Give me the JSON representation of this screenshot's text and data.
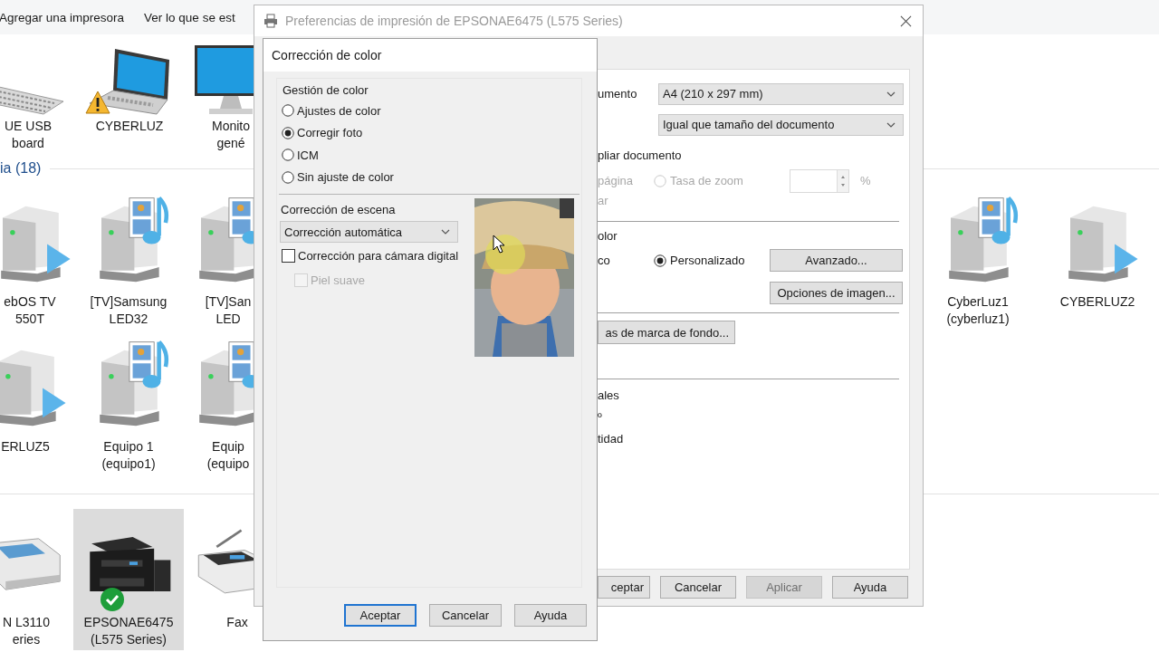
{
  "explorer": {
    "toolbar": [
      "Agregar una impresora",
      "Ver lo que se est"
    ],
    "group_heading": "ia (18)",
    "devices": [
      {
        "kind": "keyboard",
        "lines": [
          "UE USB",
          "board"
        ],
        "warning": false,
        "ok": false,
        "selected": false
      },
      {
        "kind": "laptop",
        "lines": [
          "CYBERLUZ"
        ],
        "warning": true,
        "ok": false,
        "selected": false
      },
      {
        "kind": "monitor",
        "lines": [
          "Monito",
          "gené"
        ],
        "warning": false,
        "ok": false,
        "selected": false
      },
      {
        "kind": "play-server",
        "lines": [
          "ebOS TV",
          "550T"
        ],
        "warning": false,
        "ok": false,
        "selected": false
      },
      {
        "kind": "media-server",
        "lines": [
          "[TV]Samsung",
          "LED32"
        ],
        "warning": false,
        "ok": false,
        "selected": false
      },
      {
        "kind": "media-server",
        "lines": [
          "[TV]San",
          "LED"
        ],
        "warning": false,
        "ok": false,
        "selected": false
      },
      {
        "kind": "media-server",
        "lines": [
          "CyberLuz1",
          "(cyberluz1)"
        ],
        "warning": false,
        "ok": false,
        "selected": false
      },
      {
        "kind": "play-server",
        "lines": [
          "CYBERLUZ2"
        ],
        "warning": false,
        "ok": false,
        "selected": false
      },
      {
        "kind": "play-server",
        "lines": [
          "ERLUZ5"
        ],
        "warning": false,
        "ok": false,
        "selected": false
      },
      {
        "kind": "media-server",
        "lines": [
          "Equipo 1",
          "(equipo1)"
        ],
        "warning": false,
        "ok": false,
        "selected": false
      },
      {
        "kind": "media-server",
        "lines": [
          "Equip",
          "(equipo"
        ],
        "warning": false,
        "ok": false,
        "selected": false
      },
      {
        "kind": "printer",
        "lines": [
          "N L3110",
          "eries"
        ],
        "warning": false,
        "ok": false,
        "selected": false
      },
      {
        "kind": "ink-printer",
        "lines": [
          "EPSONAE6475",
          "(L575 Series)"
        ],
        "warning": false,
        "ok": true,
        "selected": true
      },
      {
        "kind": "fax",
        "lines": [
          "Fax"
        ],
        "warning": false,
        "ok": false,
        "selected": false
      }
    ]
  },
  "preferences_window": {
    "title": "Preferencias de impresión de EPSONAE6475 (L575 Series)",
    "paper_size": {
      "label": "umento",
      "value": "A4 (210 x 297 mm)"
    },
    "output_size": {
      "value": "Igual que tamaño del documento"
    },
    "scale": {
      "label": "pliar documento",
      "fit_page": {
        "label": "página",
        "disabled": true
      },
      "zoom": {
        "label": "Tasa de zoom",
        "selected": false,
        "disabled": true
      },
      "unit": "%",
      "note": "ar"
    },
    "color": {
      "label": "olor",
      "option": "co",
      "custom": {
        "label": "Personalizado",
        "selected": true
      },
      "buttons": [
        "Avanzado...",
        "Opciones de imagen..."
      ]
    },
    "watermark_button": "as de marca de fondo...",
    "extra_lines": [
      "ales",
      "º",
      "tidad"
    ],
    "footer_buttons": [
      {
        "label": "ceptar",
        "disabled": false
      },
      {
        "label": "Cancelar",
        "disabled": false
      },
      {
        "label": "Aplicar",
        "disabled": true
      },
      {
        "label": "Ayuda",
        "disabled": false
      }
    ]
  },
  "color_dialog": {
    "title": "Corrección de color",
    "group": "Gestión de color",
    "modes": [
      {
        "label": "Ajustes de color",
        "selected": false
      },
      {
        "label": "Corregir foto",
        "selected": true
      },
      {
        "label": "ICM",
        "selected": false
      },
      {
        "label": "Sin ajuste de color",
        "selected": false
      }
    ],
    "scene": {
      "label": "Corrección de escena",
      "value": "Corrección automática"
    },
    "options": [
      {
        "label": "Corrección para cámara digital",
        "checked": false,
        "disabled": false,
        "children": [
          {
            "label": "Piel suave",
            "checked": false,
            "disabled": true
          }
        ]
      }
    ],
    "buttons": [
      {
        "label": "Aceptar",
        "default": true
      },
      {
        "label": "Cancelar",
        "default": false
      },
      {
        "label": "Ayuda",
        "default": false
      }
    ]
  }
}
